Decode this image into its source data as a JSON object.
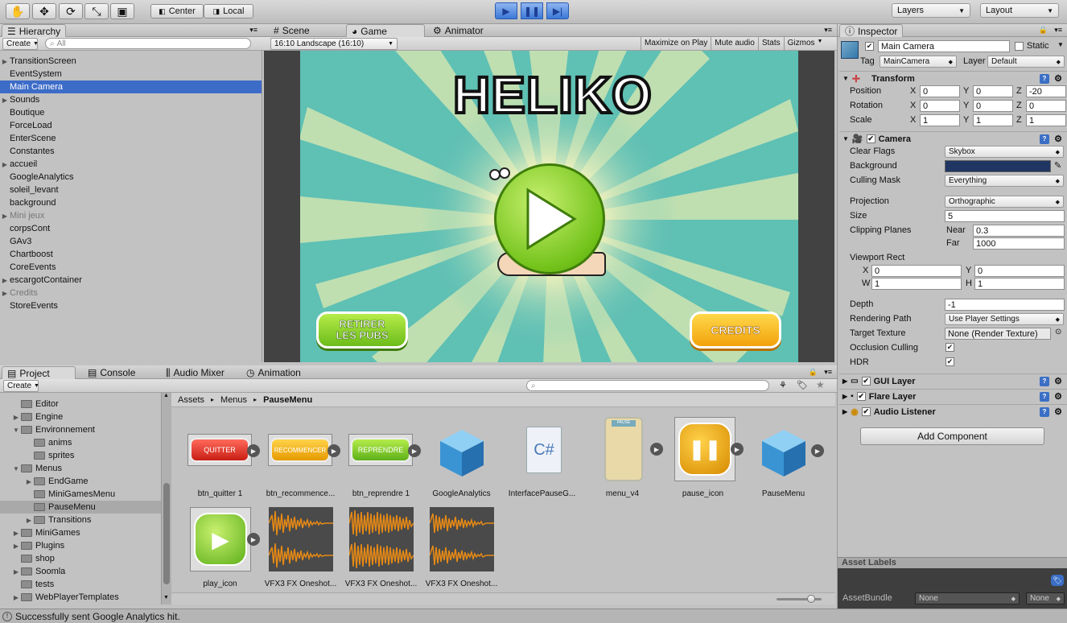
{
  "toolbar": {
    "center": "Center",
    "local": "Local",
    "layers": "Layers",
    "layout": "Layout"
  },
  "hierarchy": {
    "tab": "Hierarchy",
    "create": "Create",
    "search_placeholder": "All",
    "items": [
      {
        "label": "TransitionScreen",
        "arrow": true
      },
      {
        "label": "EventSystem",
        "arrow": false
      },
      {
        "label": "Main Camera",
        "arrow": false,
        "selected": true
      },
      {
        "label": "Sounds",
        "arrow": true
      },
      {
        "label": "Boutique",
        "arrow": false
      },
      {
        "label": "ForceLoad",
        "arrow": false
      },
      {
        "label": "EnterScene",
        "arrow": false
      },
      {
        "label": "Constantes",
        "arrow": false
      },
      {
        "label": "accueil",
        "arrow": true
      },
      {
        "label": "GoogleAnalytics",
        "arrow": false
      },
      {
        "label": "soleil_levant",
        "arrow": false
      },
      {
        "label": "background",
        "arrow": false
      },
      {
        "label": "Mini jeux",
        "arrow": true,
        "inactive": true
      },
      {
        "label": "corpsCont",
        "arrow": false
      },
      {
        "label": "GAv3",
        "arrow": false
      },
      {
        "label": "Chartboost",
        "arrow": false
      },
      {
        "label": "CoreEvents",
        "arrow": false
      },
      {
        "label": "escargotContainer",
        "arrow": true
      },
      {
        "label": "Credits",
        "arrow": true,
        "inactive": true
      },
      {
        "label": "StoreEvents",
        "arrow": false
      }
    ]
  },
  "center_tabs": {
    "scene": "Scene",
    "game": "Game",
    "animator": "Animator"
  },
  "game": {
    "aspect": "16:10 Landscape (16:10)",
    "maximize": "Maximize on Play",
    "mute": "Mute audio",
    "stats": "Stats",
    "gizmos": "Gizmos",
    "title": "HELIKO",
    "btn_left_line1": "RETIRER",
    "btn_left_line2": "LES PUBS",
    "btn_right": "CREDITS",
    "bg_color": "#5fc0b4"
  },
  "inspector": {
    "tab": "Inspector",
    "object_name": "Main Camera",
    "static": "Static",
    "tag_label": "Tag",
    "tag": "MainCamera",
    "layer_label": "Layer",
    "layer": "Default",
    "transform": {
      "title": "Transform",
      "position_label": "Position",
      "rotation_label": "Rotation",
      "scale_label": "Scale",
      "position": [
        "0",
        "0",
        "-20"
      ],
      "rotation": [
        "0",
        "0",
        "0"
      ],
      "scale": [
        "1",
        "1",
        "1"
      ]
    },
    "camera": {
      "title": "Camera",
      "clear_flags_label": "Clear Flags",
      "clear_flags": "Skybox",
      "background_label": "Background",
      "background_color": "#1f3562",
      "culling_label": "Culling Mask",
      "culling": "Everything",
      "projection_label": "Projection",
      "projection": "Orthographic",
      "size_label": "Size",
      "size": "5",
      "clipping_label": "Clipping Planes",
      "near_label": "Near",
      "near": "0.3",
      "far_label": "Far",
      "far": "1000",
      "viewport_label": "Viewport Rect",
      "vx": "0",
      "vy": "0",
      "vw": "1",
      "vh": "1",
      "depth_label": "Depth",
      "depth": "-1",
      "rendering_label": "Rendering Path",
      "rendering": "Use Player Settings",
      "target_label": "Target Texture",
      "target": "None (Render Texture)",
      "occlusion_label": "Occlusion Culling",
      "hdr_label": "HDR"
    },
    "gui_layer": "GUI Layer",
    "flare_layer": "Flare Layer",
    "audio_listener": "Audio Listener",
    "add_component": "Add Component",
    "asset_labels": "Asset Labels",
    "asset_bundle_label": "AssetBundle",
    "asset_bundle": "None",
    "asset_bundle2": "None"
  },
  "bottom_tabs": {
    "project": "Project",
    "console": "Console",
    "mixer": "Audio Mixer",
    "animation": "Animation"
  },
  "project": {
    "create": "Create",
    "breadcrumb": [
      "Assets",
      "Menus",
      "PauseMenu"
    ],
    "tree": [
      {
        "label": "Editor",
        "indent": 1,
        "arrow": false
      },
      {
        "label": "Engine",
        "indent": 1,
        "arrow": true
      },
      {
        "label": "Environnement",
        "indent": 1,
        "arrow": true,
        "open": true
      },
      {
        "label": "anims",
        "indent": 2,
        "arrow": false
      },
      {
        "label": "sprites",
        "indent": 2,
        "arrow": false
      },
      {
        "label": "Menus",
        "indent": 1,
        "arrow": true,
        "open": true
      },
      {
        "label": "EndGame",
        "indent": 2,
        "arrow": true
      },
      {
        "label": "MiniGamesMenu",
        "indent": 2,
        "arrow": false
      },
      {
        "label": "PauseMenu",
        "indent": 2,
        "arrow": false,
        "selected": true
      },
      {
        "label": "Transitions",
        "indent": 2,
        "arrow": true
      },
      {
        "label": "MiniGames",
        "indent": 1,
        "arrow": true
      },
      {
        "label": "Plugins",
        "indent": 1,
        "arrow": true
      },
      {
        "label": "shop",
        "indent": 1,
        "arrow": false
      },
      {
        "label": "Soomla",
        "indent": 1,
        "arrow": true
      },
      {
        "label": "tests",
        "indent": 1,
        "arrow": false
      },
      {
        "label": "WebPlayerTemplates",
        "indent": 1,
        "arrow": true
      }
    ],
    "assets": [
      {
        "label": "btn_quitter 1",
        "text": "QUITTER"
      },
      {
        "label": "btn_recommence...",
        "text": "RECOMMENCER"
      },
      {
        "label": "btn_reprendre 1",
        "text": "REPRENDRE"
      },
      {
        "label": "GoogleAnalytics"
      },
      {
        "label": "InterfacePauseG...",
        "text": "C#"
      },
      {
        "label": "menu_v4",
        "text": "PAUSE"
      },
      {
        "label": "pause_icon"
      },
      {
        "label": "PauseMenu"
      },
      {
        "label": "play_icon"
      },
      {
        "label": "VFX3 FX Oneshot..."
      },
      {
        "label": "VFX3 FX Oneshot..."
      },
      {
        "label": "VFX3 FX Oneshot..."
      }
    ]
  },
  "status": {
    "message": "Successfully sent Google Analytics hit."
  }
}
